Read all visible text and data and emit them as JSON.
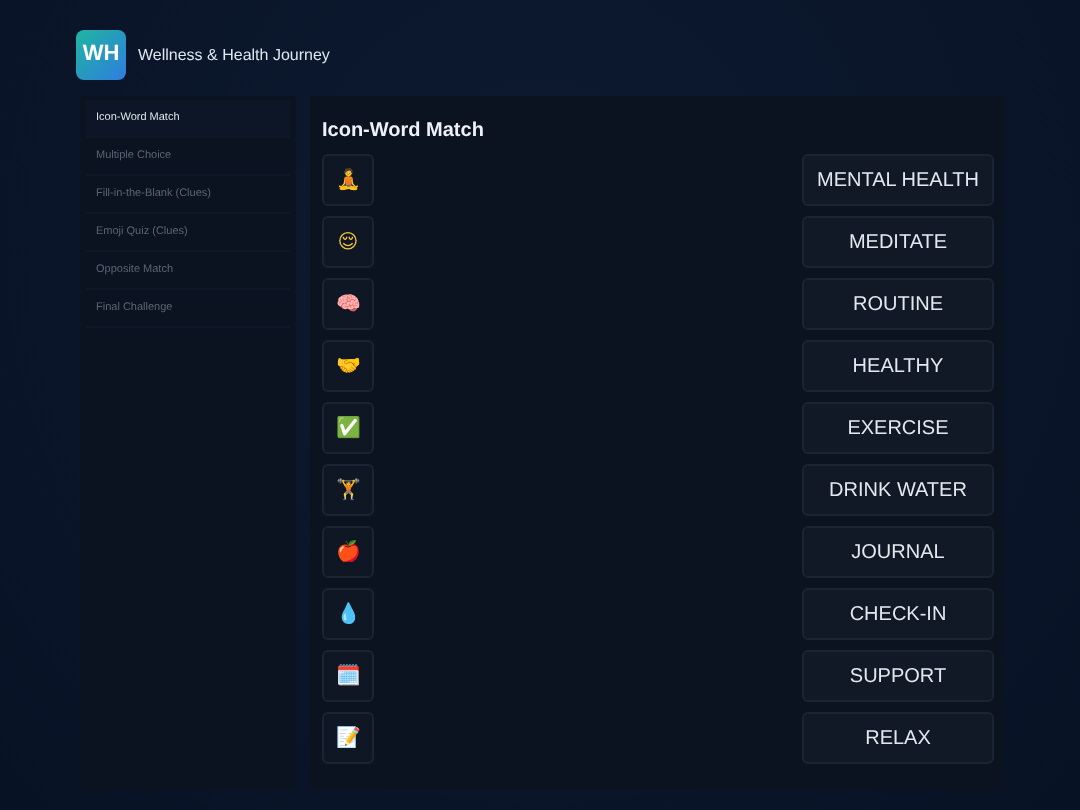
{
  "header": {
    "logo": "WH",
    "title": "Wellness & Health Journey"
  },
  "sidebar": {
    "items": [
      {
        "label": "Icon-Word Match",
        "selected": true
      },
      {
        "label": "Multiple Choice",
        "selected": false
      },
      {
        "label": "Fill-in-the-Blank (Clues)",
        "selected": false
      },
      {
        "label": "Emoji Quiz (Clues)",
        "selected": false
      },
      {
        "label": "Opposite Match",
        "selected": false
      },
      {
        "label": "Final Challenge",
        "selected": false
      }
    ]
  },
  "main": {
    "title": "Icon-Word Match",
    "icons": [
      "🧘",
      "😌",
      "🧠",
      "🤝",
      "✅",
      "🏋️",
      "🍎",
      "💧",
      "🗓️",
      "📝"
    ],
    "words": [
      "MENTAL HEALTH",
      "MEDITATE",
      "ROUTINE",
      "HEALTHY",
      "EXERCISE",
      "DRINK WATER",
      "JOURNAL",
      "CHECK-IN",
      "SUPPORT",
      "RELAX"
    ]
  }
}
